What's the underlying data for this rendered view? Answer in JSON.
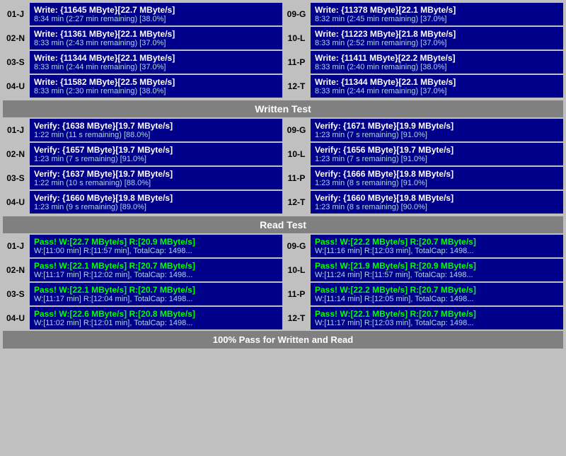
{
  "sections": {
    "write": {
      "rows": [
        {
          "left": {
            "id": "01-J",
            "line1": "Write: {11645 MByte}[22.7 MByte/s]",
            "line2": "8:34 min (2:27 min remaining)  [38.0%]"
          },
          "right": {
            "id": "09-G",
            "line1": "Write: {11378 MByte}[22.1 MByte/s]",
            "line2": "8:32 min (2:45 min remaining)  [37.0%]"
          }
        },
        {
          "left": {
            "id": "02-N",
            "line1": "Write: {11361 MByte}[22.1 MByte/s]",
            "line2": "8:33 min (2:43 min remaining)  [37.0%]"
          },
          "right": {
            "id": "10-L",
            "line1": "Write: {11223 MByte}[21.8 MByte/s]",
            "line2": "8:33 min (2:52 min remaining)  [37.0%]"
          }
        },
        {
          "left": {
            "id": "03-S",
            "line1": "Write: {11344 MByte}[22.1 MByte/s]",
            "line2": "8:33 min (2:44 min remaining)  [37.0%]"
          },
          "right": {
            "id": "11-P",
            "line1": "Write: {11411 MByte}[22.2 MByte/s]",
            "line2": "8:33 min (2:40 min remaining)  [38.0%]"
          }
        },
        {
          "left": {
            "id": "04-U",
            "line1": "Write: {11582 MByte}[22.5 MByte/s]",
            "line2": "8:33 min (2:30 min remaining)  [38.0%]"
          },
          "right": {
            "id": "12-T",
            "line1": "Write: {11344 MByte}[22.1 MByte/s]",
            "line2": "8:33 min (2:44 min remaining)  [37.0%]"
          }
        }
      ],
      "header": "Written Test"
    },
    "verify": {
      "rows": [
        {
          "left": {
            "id": "01-J",
            "line1": "Verify: {1638 MByte}[19.7 MByte/s]",
            "line2": "1:22 min (11 s remaining)  [88.0%]"
          },
          "right": {
            "id": "09-G",
            "line1": "Verify: {1671 MByte}[19.9 MByte/s]",
            "line2": "1:23 min (7 s remaining)  [91.0%]"
          }
        },
        {
          "left": {
            "id": "02-N",
            "line1": "Verify: {1657 MByte}[19.7 MByte/s]",
            "line2": "1:23 min (7 s remaining)  [91.0%]"
          },
          "right": {
            "id": "10-L",
            "line1": "Verify: {1656 MByte}[19.7 MByte/s]",
            "line2": "1:23 min (7 s remaining)  [91.0%]"
          }
        },
        {
          "left": {
            "id": "03-S",
            "line1": "Verify: {1637 MByte}[19.7 MByte/s]",
            "line2": "1:22 min (10 s remaining)  [88.0%]"
          },
          "right": {
            "id": "11-P",
            "line1": "Verify: {1666 MByte}[19.8 MByte/s]",
            "line2": "1:23 min (8 s remaining)  [91.0%]"
          }
        },
        {
          "left": {
            "id": "04-U",
            "line1": "Verify: {1660 MByte}[19.8 MByte/s]",
            "line2": "1:23 min (9 s remaining)  [89.0%]"
          },
          "right": {
            "id": "12-T",
            "line1": "Verify: {1660 MByte}[19.8 MByte/s]",
            "line2": "1:23 min (8 s remaining)  [90.0%]"
          }
        }
      ],
      "header": "Read Test"
    },
    "pass": {
      "rows": [
        {
          "left": {
            "id": "01-J",
            "line1": "Pass! W:[22.7 MByte/s] R:[20.9 MByte/s]",
            "line2": "W:[11:00 min] R:[11:57 min], TotalCap: 1498..."
          },
          "right": {
            "id": "09-G",
            "line1": "Pass! W:[22.2 MByte/s] R:[20.7 MByte/s]",
            "line2": "W:[11:16 min] R:[12:03 min], TotalCap: 1498..."
          }
        },
        {
          "left": {
            "id": "02-N",
            "line1": "Pass! W:[22.1 MByte/s] R:[20.7 MByte/s]",
            "line2": "W:[11:17 min] R:[12:02 min], TotalCap: 1498..."
          },
          "right": {
            "id": "10-L",
            "line1": "Pass! W:[21.9 MByte/s] R:[20.9 MByte/s]",
            "line2": "W:[11:24 min] R:[11:57 min], TotalCap: 1498..."
          }
        },
        {
          "left": {
            "id": "03-S",
            "line1": "Pass! W:[22.1 MByte/s] R:[20.7 MByte/s]",
            "line2": "W:[11:17 min] R:[12:04 min], TotalCap: 1498..."
          },
          "right": {
            "id": "11-P",
            "line1": "Pass! W:[22.2 MByte/s] R:[20.7 MByte/s]",
            "line2": "W:[11:14 min] R:[12:05 min], TotalCap: 1498..."
          }
        },
        {
          "left": {
            "id": "04-U",
            "line1": "Pass! W:[22.6 MByte/s] R:[20.8 MByte/s]",
            "line2": "W:[11:02 min] R:[12:01 min], TotalCap: 1498..."
          },
          "right": {
            "id": "12-T",
            "line1": "Pass! W:[22.1 MByte/s] R:[20.7 MByte/s]",
            "line2": "W:[11:17 min] R:[12:03 min], TotalCap: 1498..."
          }
        }
      ],
      "header": "Read Test"
    }
  },
  "footer": "100% Pass for Written and Read"
}
